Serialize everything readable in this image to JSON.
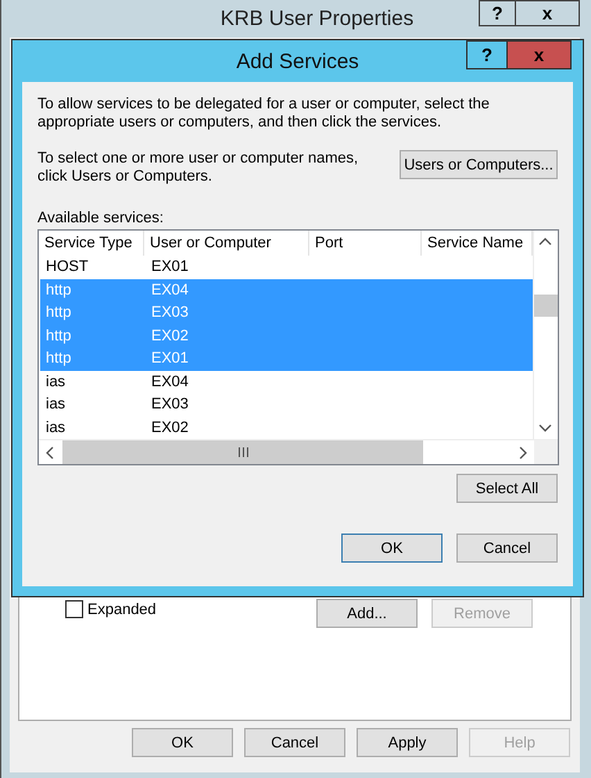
{
  "back_window": {
    "title": "KRB User Properties",
    "title_buttons": [
      "?",
      "x"
    ],
    "expanded_checkbox": {
      "label": "Expanded",
      "checked": false
    },
    "buttons": [
      {
        "label": "Add...",
        "disabled": false
      },
      {
        "label": "Remove",
        "disabled": true
      }
    ],
    "footer_buttons": [
      {
        "label": "OK",
        "disabled": false
      },
      {
        "label": "Cancel",
        "disabled": false
      },
      {
        "label": "Apply",
        "disabled": false
      },
      {
        "label": "Help",
        "disabled": true
      }
    ]
  },
  "dialog": {
    "title": "Add Services",
    "title_buttons": [
      {
        "label": "?",
        "kind": "help"
      },
      {
        "label": "x",
        "kind": "close"
      }
    ],
    "intro": "To allow services to be delegated for a user or computer, select the appropriate users or computers, and then click the services.",
    "select_hint": "To select one or more user or computer names, click Users or Computers.",
    "users_button": "Users or Computers...",
    "list_label": "Available services:",
    "table": {
      "columns": [
        "Service Type",
        "User or Computer",
        "Port",
        "Service Name"
      ],
      "rows": [
        {
          "cells": [
            "HOST",
            "EX01"
          ],
          "selected": false
        },
        {
          "cells": [
            "http",
            "EX04"
          ],
          "selected": true
        },
        {
          "cells": [
            "http",
            "EX03"
          ],
          "selected": true
        },
        {
          "cells": [
            "http",
            "EX02"
          ],
          "selected": true
        },
        {
          "cells": [
            "http",
            "EX01"
          ],
          "selected": true
        },
        {
          "cells": [
            "ias",
            "EX04"
          ],
          "selected": false
        },
        {
          "cells": [
            "ias",
            "EX03"
          ],
          "selected": false
        },
        {
          "cells": [
            "ias",
            "EX02"
          ],
          "selected": false
        }
      ]
    },
    "select_all": "Select All",
    "buttons": [
      {
        "label": "OK",
        "default": true
      },
      {
        "label": "Cancel",
        "default": false
      }
    ]
  }
}
